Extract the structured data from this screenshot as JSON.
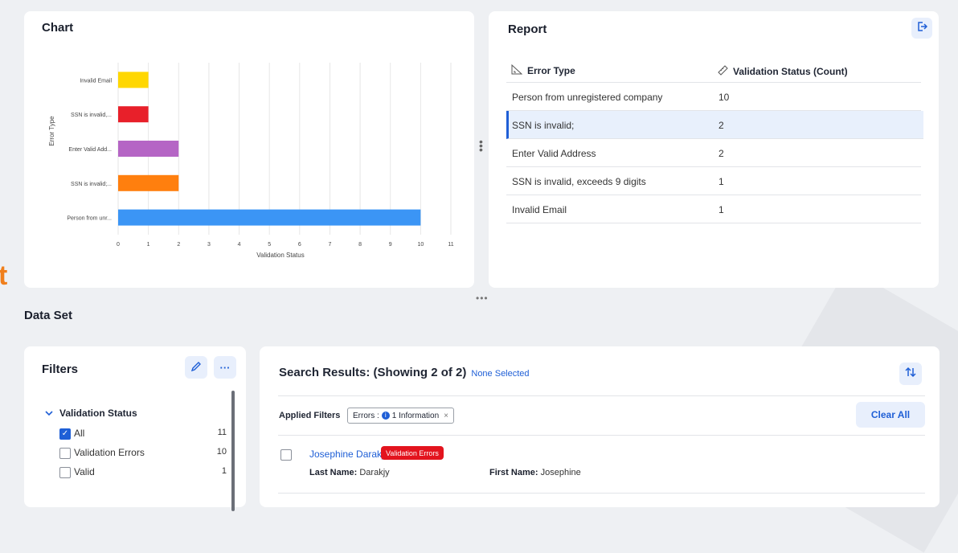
{
  "chart": {
    "title": "Chart"
  },
  "report": {
    "title": "Report",
    "export_icon": "export-icon",
    "columns": [
      "Error Type",
      "Validation Status (Count)"
    ],
    "rows": [
      {
        "error": "Person from unregistered company",
        "count": "10"
      },
      {
        "error": "SSN is invalid;",
        "count": "2"
      },
      {
        "error": "Enter Valid Address",
        "count": "2"
      },
      {
        "error": "SSN is invalid, exceeds 9 digits",
        "count": "1"
      },
      {
        "error": "Invalid Email",
        "count": "1"
      }
    ],
    "selected_row": 1
  },
  "data_set": {
    "title": "Data Set"
  },
  "edge_text": "t",
  "filters": {
    "title": "Filters",
    "more_label": "···",
    "group_label": "Validation Status",
    "items": [
      {
        "label": "All",
        "count": "11",
        "checked": true
      },
      {
        "label": "Validation Errors",
        "count": "10",
        "checked": false
      },
      {
        "label": "Valid",
        "count": "1",
        "checked": false
      }
    ]
  },
  "results": {
    "title": "Search Results: (Showing 2 of 2)",
    "none_selected": "None Selected",
    "applied_filters_label": "Applied Filters",
    "chip_prefix": "Errors :",
    "chip_value": "1 Information",
    "chip_remove": "×",
    "clear_all": "Clear All",
    "record": {
      "name": "Josephine Darakjy",
      "badge": "Validation Errors",
      "last_name_label": "Last Name:",
      "last_name": "Darakjy",
      "first_name_label": "First Name:",
      "first_name": "Josephine"
    }
  },
  "chart_data": {
    "type": "bar",
    "orientation": "horizontal",
    "categories": [
      "Invalid Email",
      "SSN is invalid,...",
      "Enter Valid Add...",
      "SSN is invalid;...",
      "Person from unr..."
    ],
    "values": [
      1,
      1,
      2,
      2,
      10
    ],
    "colors": [
      "#ffd700",
      "#e8202a",
      "#b565c5",
      "#ff7f0e",
      "#3b95f5"
    ],
    "xlabel": "Validation Status",
    "ylabel": "Error Type",
    "xlim": [
      0,
      11
    ],
    "xticks": [
      "0",
      "1",
      "2",
      "3",
      "4",
      "5",
      "6",
      "7",
      "8",
      "9",
      "10",
      "11"
    ],
    "grid": true
  }
}
